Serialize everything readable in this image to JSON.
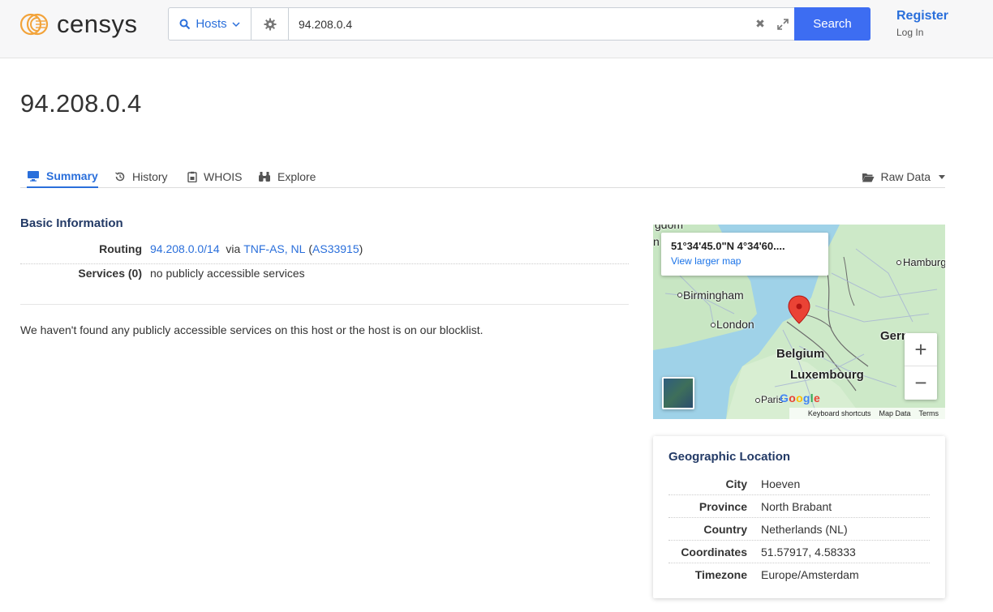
{
  "header": {
    "logo_text": "censys",
    "search_type_label": "Hosts",
    "query_value": "94.208.0.4",
    "search_button_label": "Search",
    "register_label": "Register",
    "login_label": "Log In"
  },
  "page": {
    "title": "94.208.0.4"
  },
  "tabs": [
    {
      "label": "Summary",
      "icon": "monitor-icon",
      "active": true
    },
    {
      "label": "History",
      "icon": "history-icon",
      "active": false
    },
    {
      "label": "WHOIS",
      "icon": "document-icon",
      "active": false
    },
    {
      "label": "Explore",
      "icon": "binoculars-icon",
      "active": false
    }
  ],
  "raw_data_label": "Raw Data",
  "basic_info": {
    "title": "Basic Information",
    "routing_label": "Routing",
    "routing_prefix": "94.208.0.0/14",
    "routing_via": "via",
    "routing_as_name": "TNF-AS, NL",
    "routing_open_paren": "(",
    "routing_asn": "AS33915",
    "routing_close_paren": ")",
    "services_label": "Services (0)",
    "services_value": "no publicly accessible services"
  },
  "notice": "We haven't found any publicly accessible services on this host or the host is on our blocklist.",
  "map": {
    "info_coords": "51°34'45.0\"N 4°34'60....",
    "view_larger_label": "View larger map",
    "labels": {
      "birmingham": "Birmingham",
      "london": "London",
      "belgium": "Belgium",
      "luxembourg": "Luxembourg",
      "hamburg": "Hamburg",
      "germany_partial": "Gern",
      "paris": "Paris",
      "kingdom_partial": "gdom",
      "n_partial": "n"
    },
    "zoom_in": "+",
    "zoom_out": "−",
    "google_logo": "Google",
    "footer": {
      "shortcuts": "Keyboard shortcuts",
      "map_data": "Map Data",
      "terms": "Terms"
    }
  },
  "geo": {
    "title": "Geographic Location",
    "rows": [
      {
        "label": "City",
        "value": "Hoeven"
      },
      {
        "label": "Province",
        "value": "North Brabant"
      },
      {
        "label": "Country",
        "value": "Netherlands (NL)"
      },
      {
        "label": "Coordinates",
        "value": "51.57917, 4.58333"
      },
      {
        "label": "Timezone",
        "value": "Europe/Amsterdam"
      }
    ]
  },
  "colors": {
    "accent": "#2a6fdb",
    "search_button": "#3d6df2",
    "section_title": "#233a66",
    "map_pin": "#ea4335"
  }
}
